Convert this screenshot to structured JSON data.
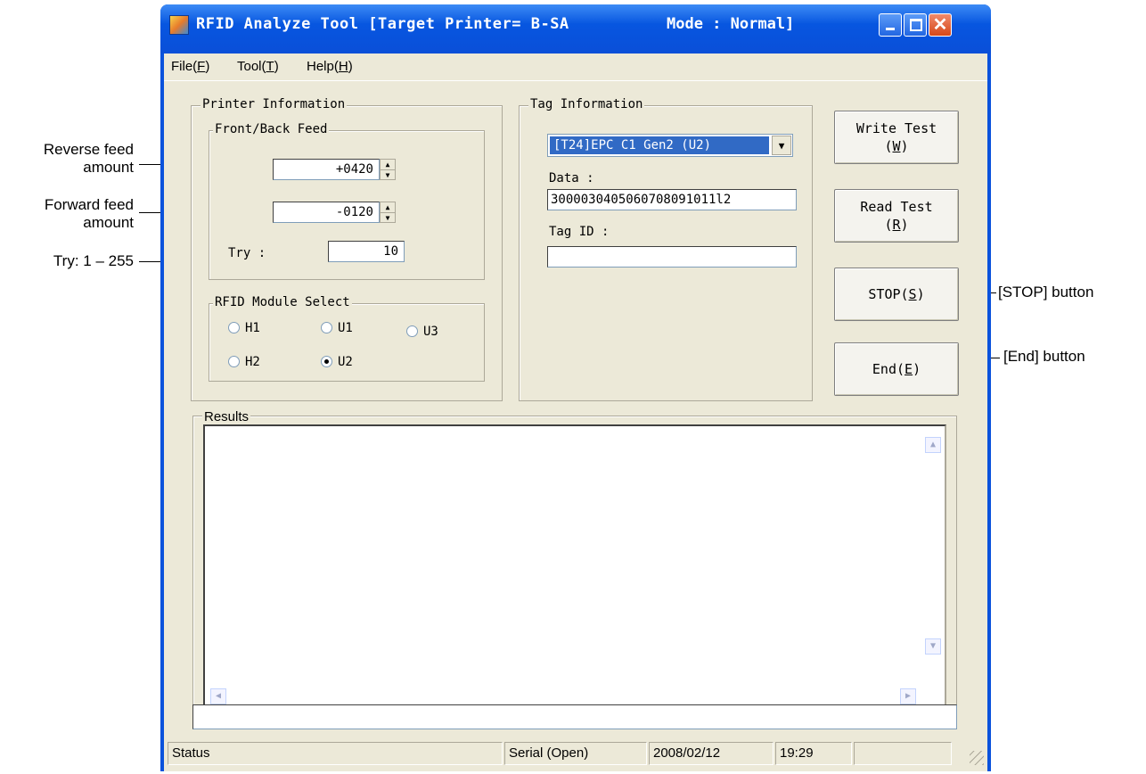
{
  "window": {
    "title": "RFID Analyze Tool [Target Printer= B-SA",
    "mode": "Mode : Normal]"
  },
  "menu": [
    {
      "label": "File(",
      "key": "F"
    },
    {
      "label": "Tool(",
      "key": "T"
    },
    {
      "label": "Help(",
      "key": "H"
    }
  ],
  "printer_info": {
    "legend": "Printer Information",
    "feed_legend": "Front/Back Feed",
    "reverse_value": "+0420",
    "forward_value": "-0120",
    "try_label": "Try :",
    "try_value": "10"
  },
  "module_select": {
    "legend": "RFID Module Select",
    "options": [
      {
        "label": "H1",
        "selected": false
      },
      {
        "label": "U1",
        "selected": false
      },
      {
        "label": "U3",
        "selected": false
      },
      {
        "label": "H2",
        "selected": false
      },
      {
        "label": "U2",
        "selected": true
      }
    ]
  },
  "tag_info": {
    "legend": "Tag Information",
    "tag_type": "[T24]EPC C1 Gen2 (U2)",
    "data_label": "Data :",
    "data_value": "3000030405060708091011l2",
    "tag_id_label": "Tag ID :",
    "tag_id_value": ""
  },
  "buttons": {
    "write_test": "Write Test",
    "write_key": "W",
    "read_test": "Read Test",
    "read_key": "R",
    "stop": "STOP(",
    "stop_key": "S",
    "end": "End(",
    "end_key": "E"
  },
  "results": {
    "legend": "Results"
  },
  "status": {
    "status": "Status",
    "port": "Serial (Open)",
    "date": "2008/02/12",
    "time": "19:29"
  },
  "callouts": {
    "reverse_feed": [
      "Reverse feed",
      "amount"
    ],
    "forward_feed": [
      "Forward feed",
      "amount"
    ],
    "try": "Try: 1 – 255",
    "stop": "[STOP] button",
    "end": "[End] button"
  }
}
